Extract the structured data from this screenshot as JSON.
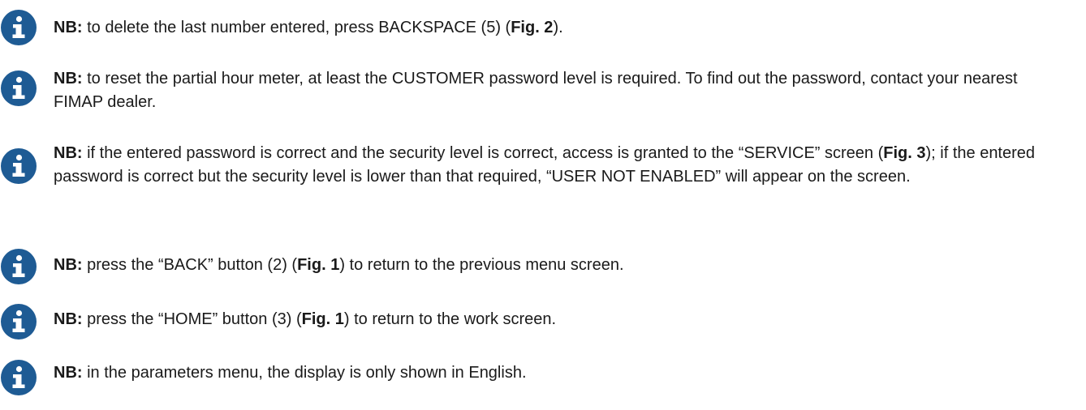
{
  "accent_color": "#1e5b94",
  "icon": "info-icon",
  "notes": [
    {
      "label": "NB:",
      "parts": [
        {
          "t": " to delete the last number entered, press BACKSPACE (5) (",
          "b": false
        },
        {
          "t": "Fig. 2",
          "b": true
        },
        {
          "t": ").",
          "b": false
        }
      ]
    },
    {
      "label": "NB:",
      "parts": [
        {
          "t": " to reset the partial hour meter, at least the CUSTOMER password level is required. To find out the password, contact your nearest FIMAP dealer.",
          "b": false
        }
      ]
    },
    {
      "label": "NB:",
      "parts": [
        {
          "t": " if the entered password is correct and the security level is correct, access is granted to the “SERVICE” screen (",
          "b": false
        },
        {
          "t": "Fig. 3",
          "b": true
        },
        {
          "t": "); if the entered password is correct but the security level is lower than that required, “USER NOT ENABLED” will appear on the screen.",
          "b": false
        }
      ]
    },
    {
      "label": "NB:",
      "parts": [
        {
          "t": " press the “BACK” button (2) (",
          "b": false
        },
        {
          "t": "Fig. 1",
          "b": true
        },
        {
          "t": ") to return to the previous menu screen.",
          "b": false
        }
      ]
    },
    {
      "label": "NB:",
      "parts": [
        {
          "t": " press the “HOME” button (3) (",
          "b": false
        },
        {
          "t": "Fig. 1",
          "b": true
        },
        {
          "t": ") to return to the work screen.",
          "b": false
        }
      ]
    },
    {
      "label": "NB:",
      "parts": [
        {
          "t": " in the parameters menu, the display is only shown in English.",
          "b": false
        }
      ]
    }
  ]
}
